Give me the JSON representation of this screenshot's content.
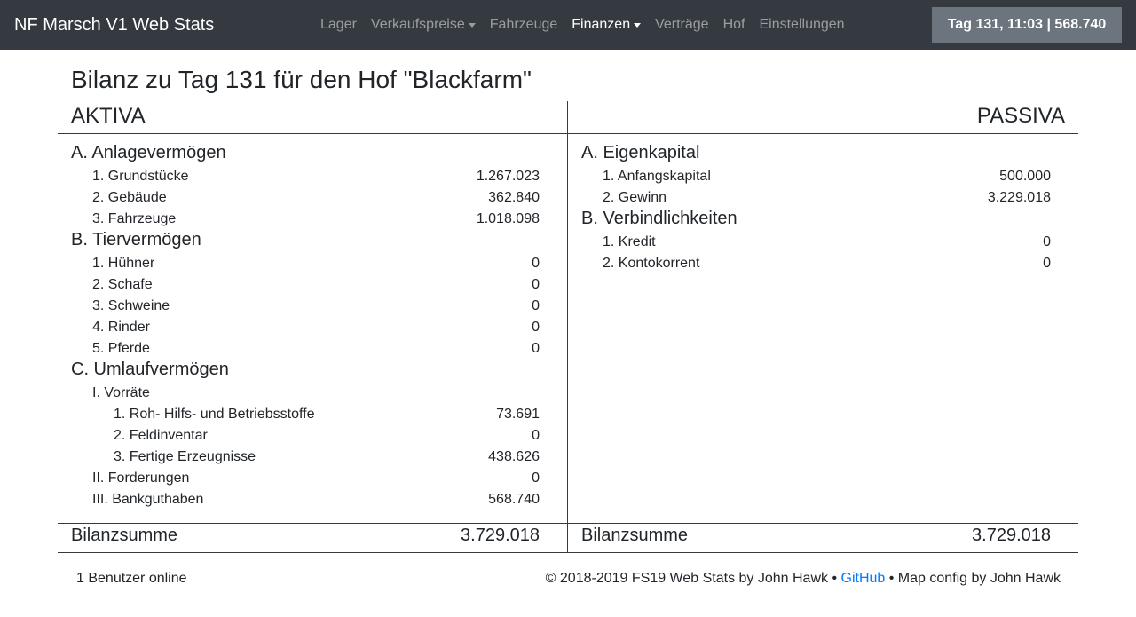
{
  "navbar": {
    "brand": "NF Marsch V1 Web Stats",
    "items": [
      {
        "label": "Lager"
      },
      {
        "label": "Verkaufspreise"
      },
      {
        "label": "Fahrzeuge"
      },
      {
        "label": "Finanzen"
      },
      {
        "label": "Verträge"
      },
      {
        "label": "Hof"
      },
      {
        "label": "Einstellungen"
      }
    ],
    "status": "Tag 131, 11:03 | 568.740"
  },
  "page": {
    "title": "Bilanz zu Tag 131 für den Hof \"Blackfarm\""
  },
  "aktiva": {
    "header": "AKTIVA",
    "A": {
      "title": "A. Anlagevermögen",
      "items": [
        {
          "label": "1. Grundstücke",
          "value": "1.267.023"
        },
        {
          "label": "2. Gebäude",
          "value": "362.840"
        },
        {
          "label": "3. Fahrzeuge",
          "value": "1.018.098"
        }
      ]
    },
    "B": {
      "title": "B. Tiervermögen",
      "items": [
        {
          "label": "1. Hühner",
          "value": "0"
        },
        {
          "label": "2. Schafe",
          "value": "0"
        },
        {
          "label": "3. Schweine",
          "value": "0"
        },
        {
          "label": "4. Rinder",
          "value": "0"
        },
        {
          "label": "5. Pferde",
          "value": "0"
        }
      ]
    },
    "C": {
      "title": "C. Umlaufvermögen",
      "vorraete": "I. Vorräte",
      "vorraete_items": [
        {
          "label": "1. Roh- Hilfs- und Betriebsstoffe",
          "value": "73.691"
        },
        {
          "label": "2. Feldinventar",
          "value": "0"
        },
        {
          "label": "3. Fertige Erzeugnisse",
          "value": "438.626"
        }
      ],
      "forderungen": {
        "label": "II. Forderungen",
        "value": "0"
      },
      "bankguthaben": {
        "label": "III. Bankguthaben",
        "value": "568.740"
      }
    },
    "sum_label": "Bilanzsumme",
    "sum_value": "3.729.018"
  },
  "passiva": {
    "header": "PASSIVA",
    "A": {
      "title": "A. Eigenkapital",
      "items": [
        {
          "label": "1. Anfangskapital",
          "value": "500.000"
        },
        {
          "label": "2. Gewinn",
          "value": "3.229.018"
        }
      ]
    },
    "B": {
      "title": "B. Verbindlichkeiten",
      "items": [
        {
          "label": "1. Kredit",
          "value": "0"
        },
        {
          "label": "2. Kontokorrent",
          "value": "0"
        }
      ]
    },
    "sum_label": "Bilanzsumme",
    "sum_value": "3.729.018"
  },
  "footer": {
    "users_online": "1 Benutzer online",
    "copyright": "© 2018-2019 FS19 Web Stats by John Hawk • ",
    "github": "GitHub",
    "map_config": " • Map config by John Hawk"
  }
}
